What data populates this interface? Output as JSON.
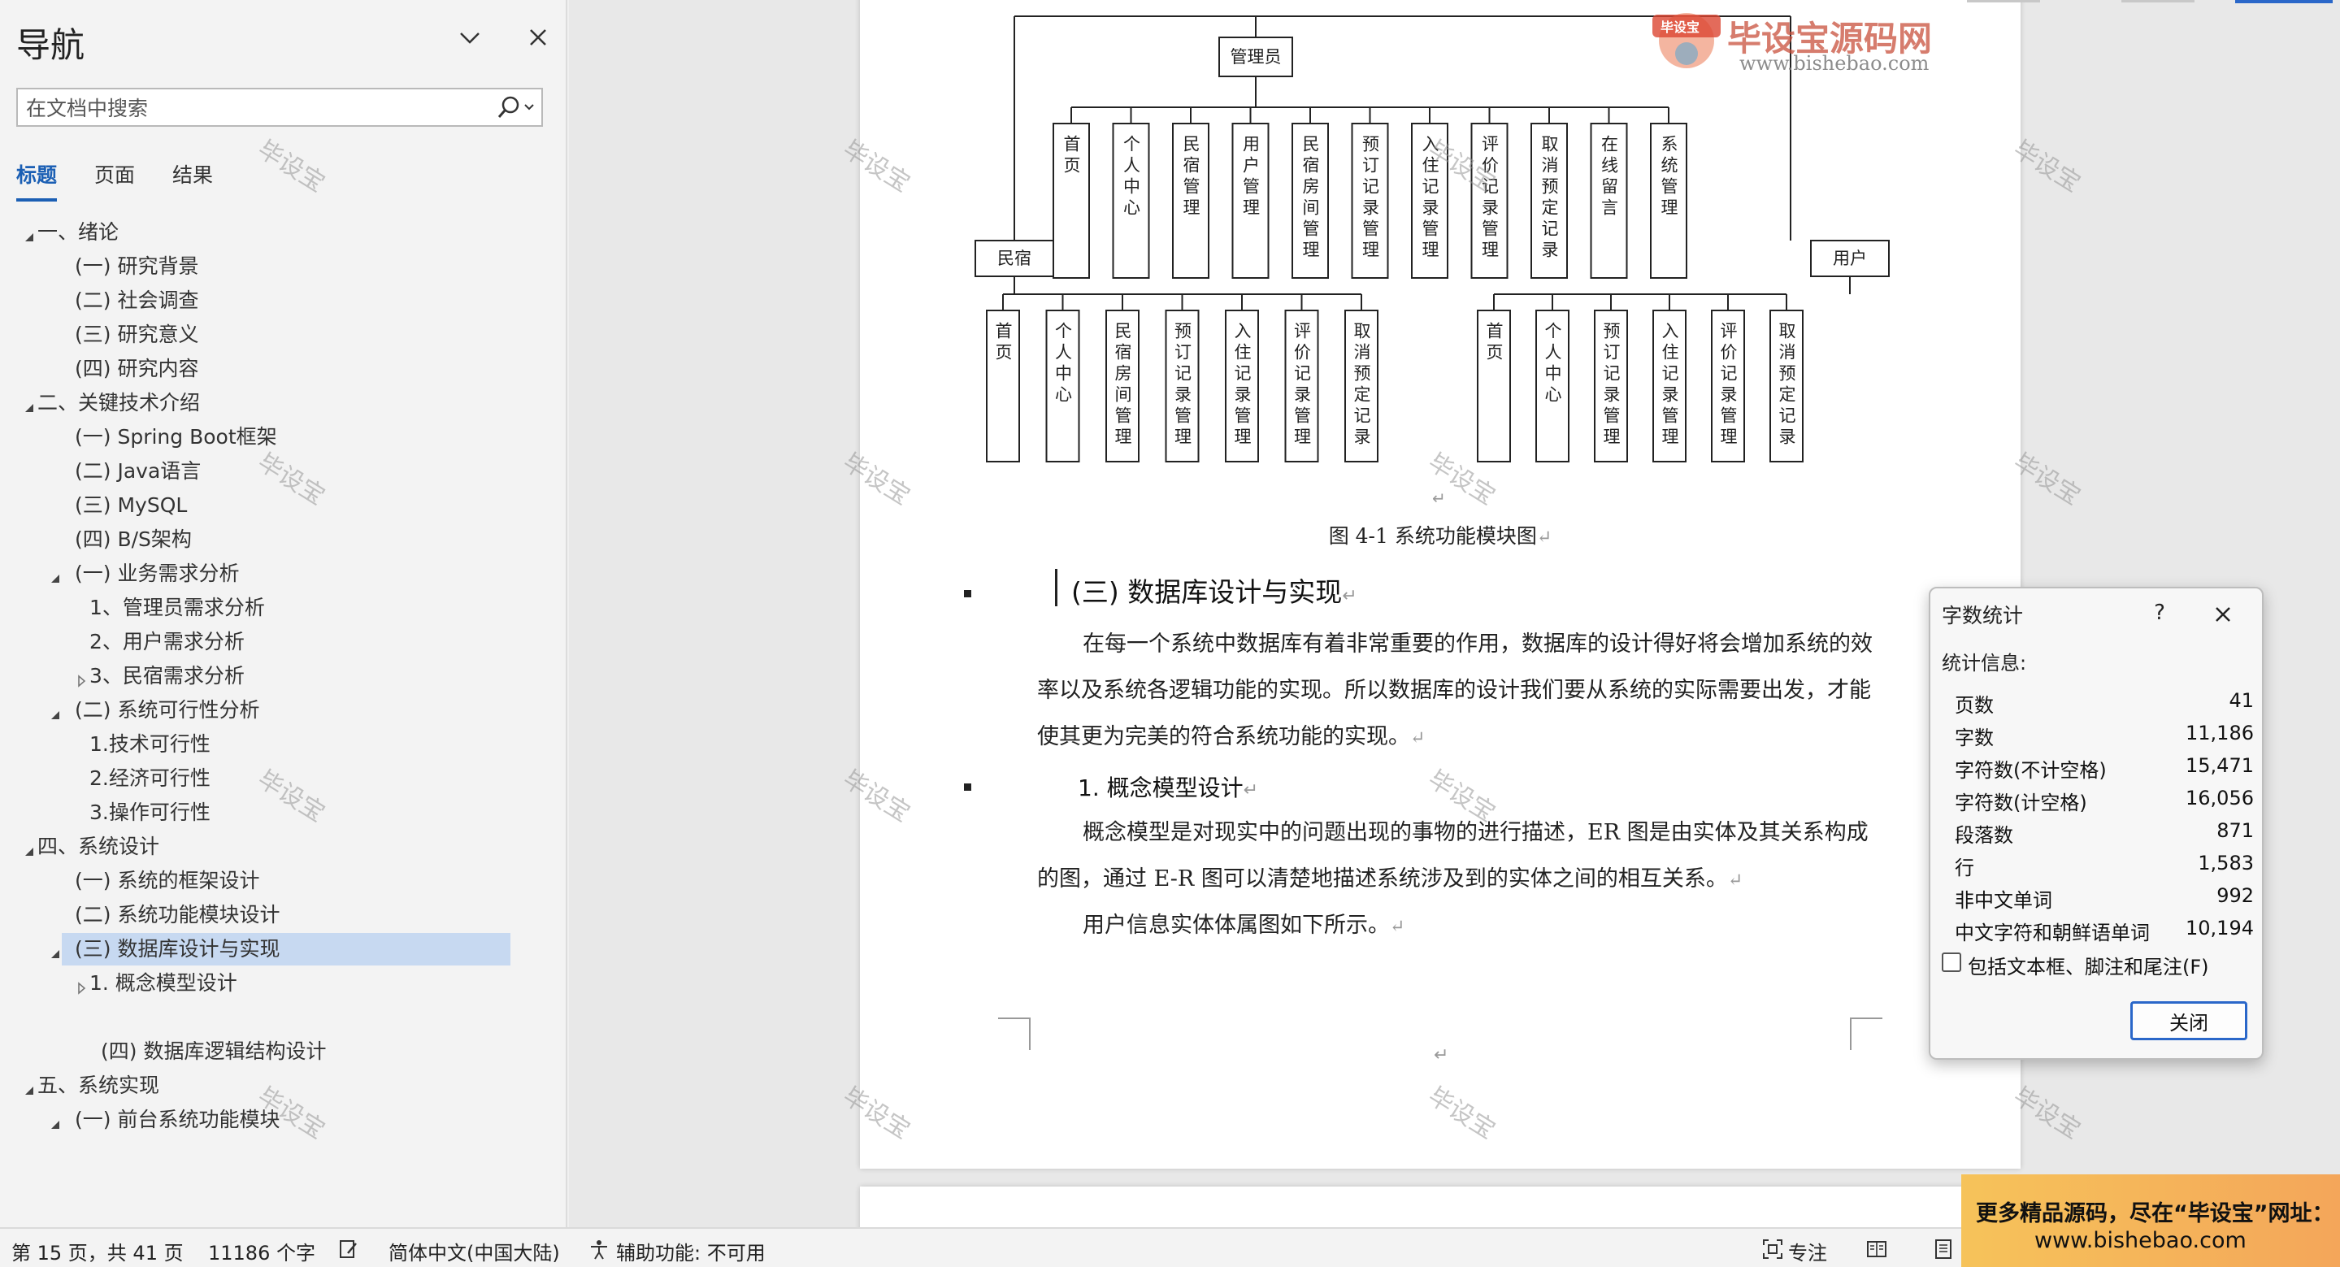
{
  "nav": {
    "title": "导航",
    "search_placeholder": "在文档中搜索",
    "tabs": [
      {
        "label": "标题",
        "active": true
      },
      {
        "label": "页面",
        "active": false
      },
      {
        "label": "结果",
        "active": false
      }
    ],
    "tree": [
      {
        "label": "一、绪论",
        "level": 0,
        "arrow": "expanded"
      },
      {
        "label": "(一) 研究背景",
        "level": 1,
        "arrow": "none"
      },
      {
        "label": "(二) 社会调查",
        "level": 1,
        "arrow": "none"
      },
      {
        "label": "(三) 研究意义",
        "level": 1,
        "arrow": "none"
      },
      {
        "label": "(四) 研究内容",
        "level": 1,
        "arrow": "none"
      },
      {
        "label": "二、关键技术介绍",
        "level": 0,
        "arrow": "expanded"
      },
      {
        "label": "(一)  Spring Boot框架",
        "level": 1,
        "arrow": "none"
      },
      {
        "label": "(二) Java语言",
        "level": 1,
        "arrow": "none"
      },
      {
        "label": "(三) MySQL",
        "level": 1,
        "arrow": "none"
      },
      {
        "label": "(四) B/S架构",
        "level": 1,
        "arrow": "none"
      },
      {
        "label": "(一) 业务需求分析",
        "level": 1,
        "arrow": "expanded"
      },
      {
        "label": "1、管理员需求分析",
        "level": 2,
        "arrow": "none"
      },
      {
        "label": "2、用户需求分析",
        "level": 2,
        "arrow": "none"
      },
      {
        "label": "3、民宿需求分析",
        "level": 2,
        "arrow": "collapsed"
      },
      {
        "label": "(二) 系统可行性分析",
        "level": 1,
        "arrow": "expanded"
      },
      {
        "label": "1.技术可行性",
        "level": 2,
        "arrow": "none"
      },
      {
        "label": "2.经济可行性",
        "level": 2,
        "arrow": "none"
      },
      {
        "label": "3.操作可行性",
        "level": 2,
        "arrow": "none"
      },
      {
        "label": "四、系统设计",
        "level": 0,
        "arrow": "expanded"
      },
      {
        "label": "(一) 系统的框架设计",
        "level": 1,
        "arrow": "none"
      },
      {
        "label": "(二) 系统功能模块设计",
        "level": 1,
        "arrow": "none"
      },
      {
        "label": "(三)  数据库设计与实现",
        "level": 1,
        "arrow": "expanded",
        "selected": true
      },
      {
        "label": "1. 概念模型设计",
        "level": 2,
        "arrow": "collapsed"
      },
      {
        "label": "",
        "level": 2,
        "arrow": "none"
      },
      {
        "label": "(四) 数据库逻辑结构设计",
        "level": 3,
        "arrow": "none"
      },
      {
        "label": "五、系统实现",
        "level": 0,
        "arrow": "expanded"
      },
      {
        "label": "(一) 前台系统功能模块",
        "level": 1,
        "arrow": "expanded"
      }
    ]
  },
  "doc": {
    "diagram": {
      "root": "管理员",
      "admin_children": [
        "首页",
        "个人中心",
        "民宿管理",
        "用户管理",
        "民宿房间管理",
        "预订记录管理",
        "入住记录管理",
        "评价记录管理",
        "取消预定记录",
        "在线留言",
        "系统管理"
      ],
      "left_group": "民宿",
      "left_children": [
        "首页",
        "个人中心",
        "民宿房间管理",
        "预订记录管理",
        "入住记录管理",
        "评价记录管理",
        "取消预定记录"
      ],
      "right_group": "用户",
      "right_children": [
        "首页",
        "个人中心",
        "预订记录管理",
        "入住记录管理",
        "评价记录管理",
        "取消预定记录"
      ]
    },
    "figure_caption": "图 4-1 系统功能模块图",
    "heading3": "(三)  数据库设计与实现",
    "para1": "在每一个系统中数据库有着非常重要的作用，数据库的设计得好将会增加系统的效率以及系统各逻辑功能的实现。所以数据库的设计我们要从系统的实际需要出发，才能使其更为完美的符合系统功能的实现。",
    "heading4": "1. 概念模型设计",
    "para2": "概念模型是对现实中的问题出现的事物的进行描述，ER 图是由实体及其关系构成的图，通过 E-R 图可以清楚地描述系统涉及到的实体之间的相互关系。",
    "para3": "用户信息实体体属图如下所示。"
  },
  "watermark": {
    "text": "毕设宝",
    "logo_cn": "毕设宝源码网",
    "logo_url": "www.bishebao.com",
    "logo_badge": "毕设宝"
  },
  "dialog": {
    "title": "字数统计",
    "help": "?",
    "section": "统计信息:",
    "stats": [
      {
        "label": "页数",
        "value": "41"
      },
      {
        "label": "字数",
        "value": "11,186"
      },
      {
        "label": "字符数(不计空格)",
        "value": "15,471"
      },
      {
        "label": "字符数(计空格)",
        "value": "16,056"
      },
      {
        "label": "段落数",
        "value": "871"
      },
      {
        "label": "行",
        "value": "1,583"
      },
      {
        "label": "非中文单词",
        "value": "992"
      },
      {
        "label": "中文字符和朝鲜语单词",
        "value": "10,194"
      }
    ],
    "checkbox_label": "包括文本框、脚注和尾注(F)",
    "close_label": "关闭"
  },
  "status": {
    "page": "第 15 页，共 41 页",
    "words": "11186 个字",
    "language": "简体中文(中国大陆)",
    "accessibility": "辅助功能: 不可用",
    "focus": "专注"
  },
  "promo": {
    "line1": "更多精品源码，尽在“毕设宝”网址：",
    "line2": "www.bishebao.com"
  },
  "colors": {
    "accent": "#1b5fb4",
    "selection": "#c7d9f1",
    "dialog_button_border": "#2a67c9",
    "promo_gradient_start": "#f6c35a"
  }
}
